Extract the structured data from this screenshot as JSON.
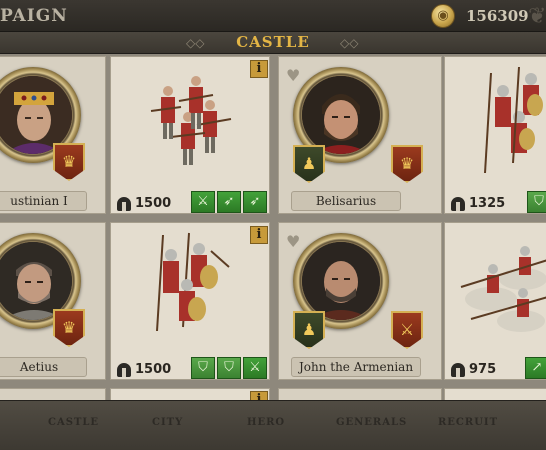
{
  "header": {
    "title": "PAIGN",
    "gold": "156309",
    "coin_icon": "coin-icon",
    "laurel_icon": "laurel-icon"
  },
  "section": {
    "label": "CASTLE"
  },
  "generals": [
    {
      "name": "ustinian I",
      "rank_badge": "crown-badge"
    },
    {
      "name": "Belisarius",
      "rank_badge": "crown-badge"
    },
    {
      "name": "Aetius",
      "rank_badge": "crown-badge"
    },
    {
      "name": "John the Armenian",
      "rank_badge": "sword-badge"
    }
  ],
  "units": [
    {
      "strength": "1500",
      "abilities": [
        "crossed-swords",
        "bow",
        "bow"
      ]
    },
    {
      "strength": "1325",
      "abilities": [
        "shield"
      ]
    },
    {
      "strength": "1500",
      "abilities": [
        "shield",
        "shield",
        "crossed-swords"
      ]
    },
    {
      "strength": "975",
      "abilities": [
        "lance"
      ]
    }
  ],
  "info_label": "i",
  "bottom_tabs": [
    "CASTLE",
    "CITY",
    "HERO",
    "GENERALS",
    "RECRUIT"
  ],
  "colors": {
    "accent_gold": "#e3b545",
    "ability_green": "#3a9a31",
    "badge_red": "#8a2f18"
  }
}
